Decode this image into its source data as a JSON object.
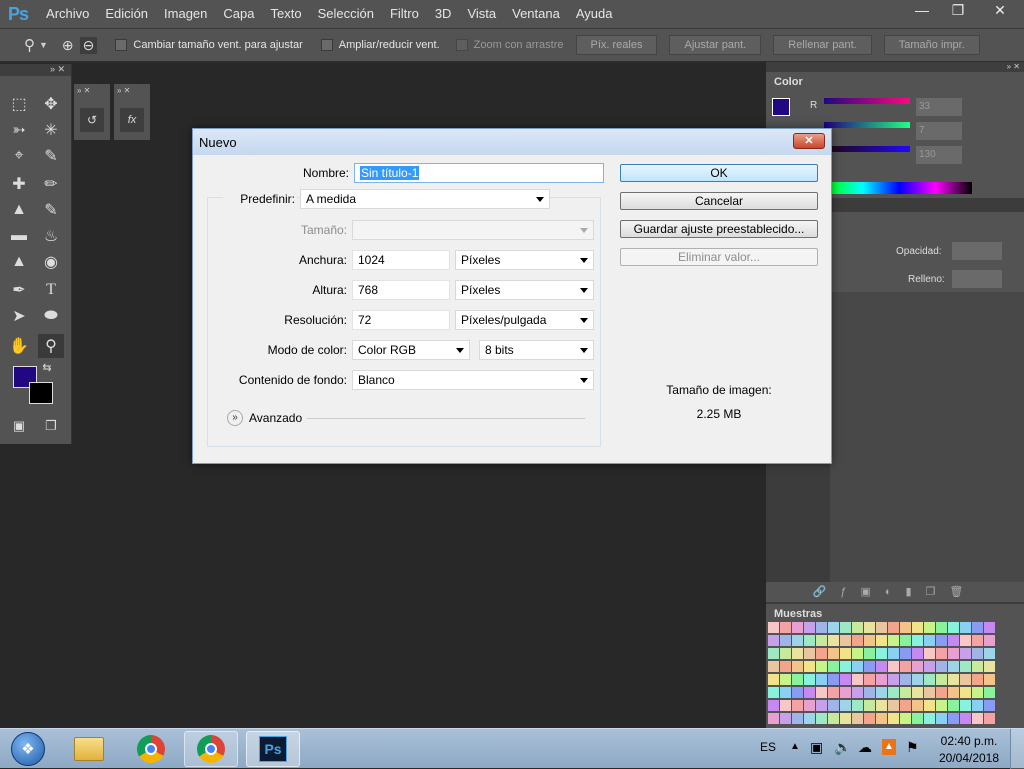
{
  "app": {
    "logo": "Ps"
  },
  "menu": [
    "Archivo",
    "Edición",
    "Imagen",
    "Capa",
    "Texto",
    "Selección",
    "Filtro",
    "3D",
    "Vista",
    "Ventana",
    "Ayuda"
  ],
  "options": {
    "resize_label": "Cambiar tamaño vent. para ajustar",
    "zoom_all_label": "Ampliar/reducir vent.",
    "scrubby_label": "Zoom con arrastre",
    "actual_pixels": "Píx. reales",
    "fit_screen": "Ajustar pant.",
    "fill_screen": "Rellenar pant.",
    "print_size": "Tamaño impr."
  },
  "color_panel": {
    "title": "Color",
    "r_label": "R",
    "r": "33",
    "g": "7",
    "b": "130",
    "fg_color": "#210782"
  },
  "layers_panel": {
    "opacity_label": "Opacidad:",
    "fill_label": "Relleno:"
  },
  "swatches_panel": {
    "title": "Muestras"
  },
  "dialog": {
    "title": "Nuevo",
    "name_label": "Nombre:",
    "name_value": "Sin título-1",
    "preset_label": "Predefinir:",
    "preset_value": "A medida",
    "size_label": "Tamaño:",
    "width_label": "Anchura:",
    "width_value": "1024",
    "width_unit": "Píxeles",
    "height_label": "Altura:",
    "height_value": "768",
    "height_unit": "Píxeles",
    "resolution_label": "Resolución:",
    "resolution_value": "72",
    "resolution_unit": "Píxeles/pulgada",
    "color_mode_label": "Modo de color:",
    "color_mode_value": "Color RGB",
    "bit_depth": "8 bits",
    "background_label": "Contenido de fondo:",
    "background_value": "Blanco",
    "advanced_label": "Avanzado",
    "ok": "OK",
    "cancel": "Cancelar",
    "save_preset": "Guardar ajuste preestablecido...",
    "delete_preset": "Eliminar valor...",
    "image_size_label": "Tamaño de imagen:",
    "image_size_value": "2.25 MB"
  },
  "taskbar": {
    "lang": "ES",
    "time": "02:40 p.m.",
    "date": "20/04/2018",
    "ps_label": "Ps"
  }
}
